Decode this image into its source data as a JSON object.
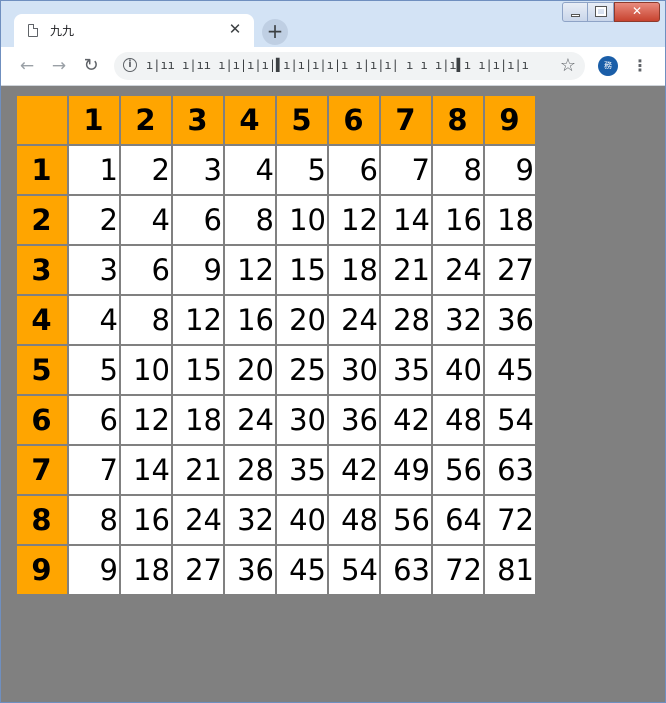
{
  "browser": {
    "tab_title": "九九",
    "tab_close": "✕",
    "new_tab": "+",
    "url": "ı|ıı  ı|ıı  ı|ı|ı|ı|▌ı|ı|ı|ı|ı  ı|ı|ı|  ı ı ı|ı▌ı ı|ı|ı|ı",
    "avatar_text": "務",
    "nav": {
      "back": "←",
      "forward": "→",
      "reload": "↻"
    },
    "star": "☆",
    "menu": "⋮",
    "info": "i"
  },
  "colors": {
    "header_bg": "#ffa500",
    "cell_bg": "#ffffff",
    "page_bg": "#808080"
  },
  "table": {
    "corner": "",
    "col_headers": [
      "1",
      "2",
      "3",
      "4",
      "5",
      "6",
      "7",
      "8",
      "9"
    ],
    "rows": [
      {
        "header": "1",
        "cells": [
          "1",
          "2",
          "3",
          "4",
          "5",
          "6",
          "7",
          "8",
          "9"
        ]
      },
      {
        "header": "2",
        "cells": [
          "2",
          "4",
          "6",
          "8",
          "10",
          "12",
          "14",
          "16",
          "18"
        ]
      },
      {
        "header": "3",
        "cells": [
          "3",
          "6",
          "9",
          "12",
          "15",
          "18",
          "21",
          "24",
          "27"
        ]
      },
      {
        "header": "4",
        "cells": [
          "4",
          "8",
          "12",
          "16",
          "20",
          "24",
          "28",
          "32",
          "36"
        ]
      },
      {
        "header": "5",
        "cells": [
          "5",
          "10",
          "15",
          "20",
          "25",
          "30",
          "35",
          "40",
          "45"
        ]
      },
      {
        "header": "6",
        "cells": [
          "6",
          "12",
          "18",
          "24",
          "30",
          "36",
          "42",
          "48",
          "54"
        ]
      },
      {
        "header": "7",
        "cells": [
          "7",
          "14",
          "21",
          "28",
          "35",
          "42",
          "49",
          "56",
          "63"
        ]
      },
      {
        "header": "8",
        "cells": [
          "8",
          "16",
          "24",
          "32",
          "40",
          "48",
          "56",
          "64",
          "72"
        ]
      },
      {
        "header": "9",
        "cells": [
          "9",
          "18",
          "27",
          "36",
          "45",
          "54",
          "63",
          "72",
          "81"
        ]
      }
    ]
  }
}
